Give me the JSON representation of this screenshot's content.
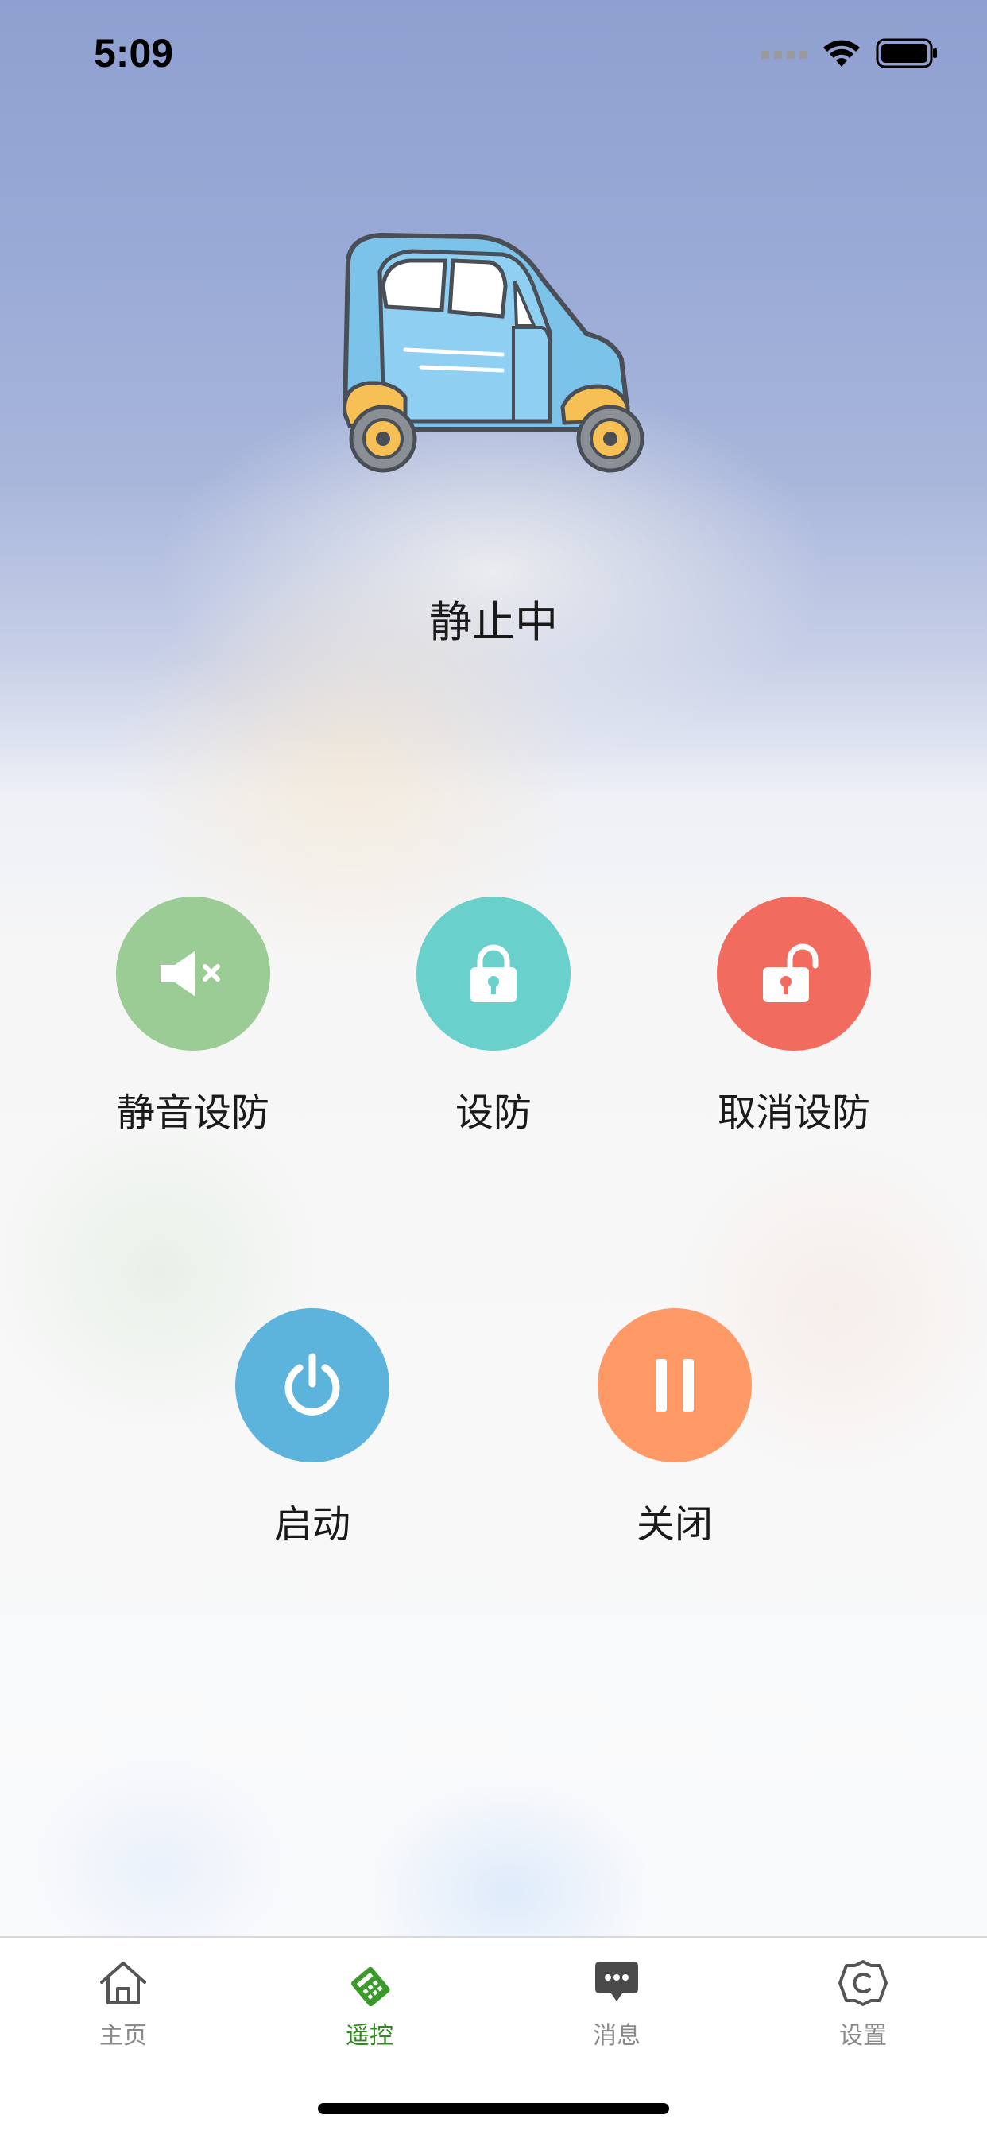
{
  "status_bar": {
    "time": "5:09",
    "icons": [
      "signal-icon",
      "wifi-icon",
      "battery-icon"
    ]
  },
  "vehicle": {
    "image": "electric-car-image",
    "state": "静止中"
  },
  "actions": [
    {
      "name": "silent-arm",
      "label": "静音设防",
      "icon": "speaker-mute-icon",
      "color": "#9ccc96"
    },
    {
      "name": "arm",
      "label": "设防",
      "icon": "lock-icon",
      "color": "#6ad0cb"
    },
    {
      "name": "disarm",
      "label": "取消设防",
      "icon": "unlock-icon",
      "color": "#f26b5f"
    },
    {
      "name": "start",
      "label": "启动",
      "icon": "power-icon",
      "color": "#5cb3dc"
    },
    {
      "name": "stop",
      "label": "关闭",
      "icon": "pause-icon",
      "color": "#ff9966"
    }
  ],
  "tabbar": {
    "items": [
      {
        "label": "主页",
        "icon": "home-icon",
        "active": false
      },
      {
        "label": "遥控",
        "icon": "remote-icon",
        "active": true
      },
      {
        "label": "消息",
        "icon": "message-icon",
        "active": false
      },
      {
        "label": "设置",
        "icon": "settings-icon",
        "active": false
      }
    ],
    "active_color": "#2e8b1e",
    "inactive_color": "#8a8a8a"
  }
}
